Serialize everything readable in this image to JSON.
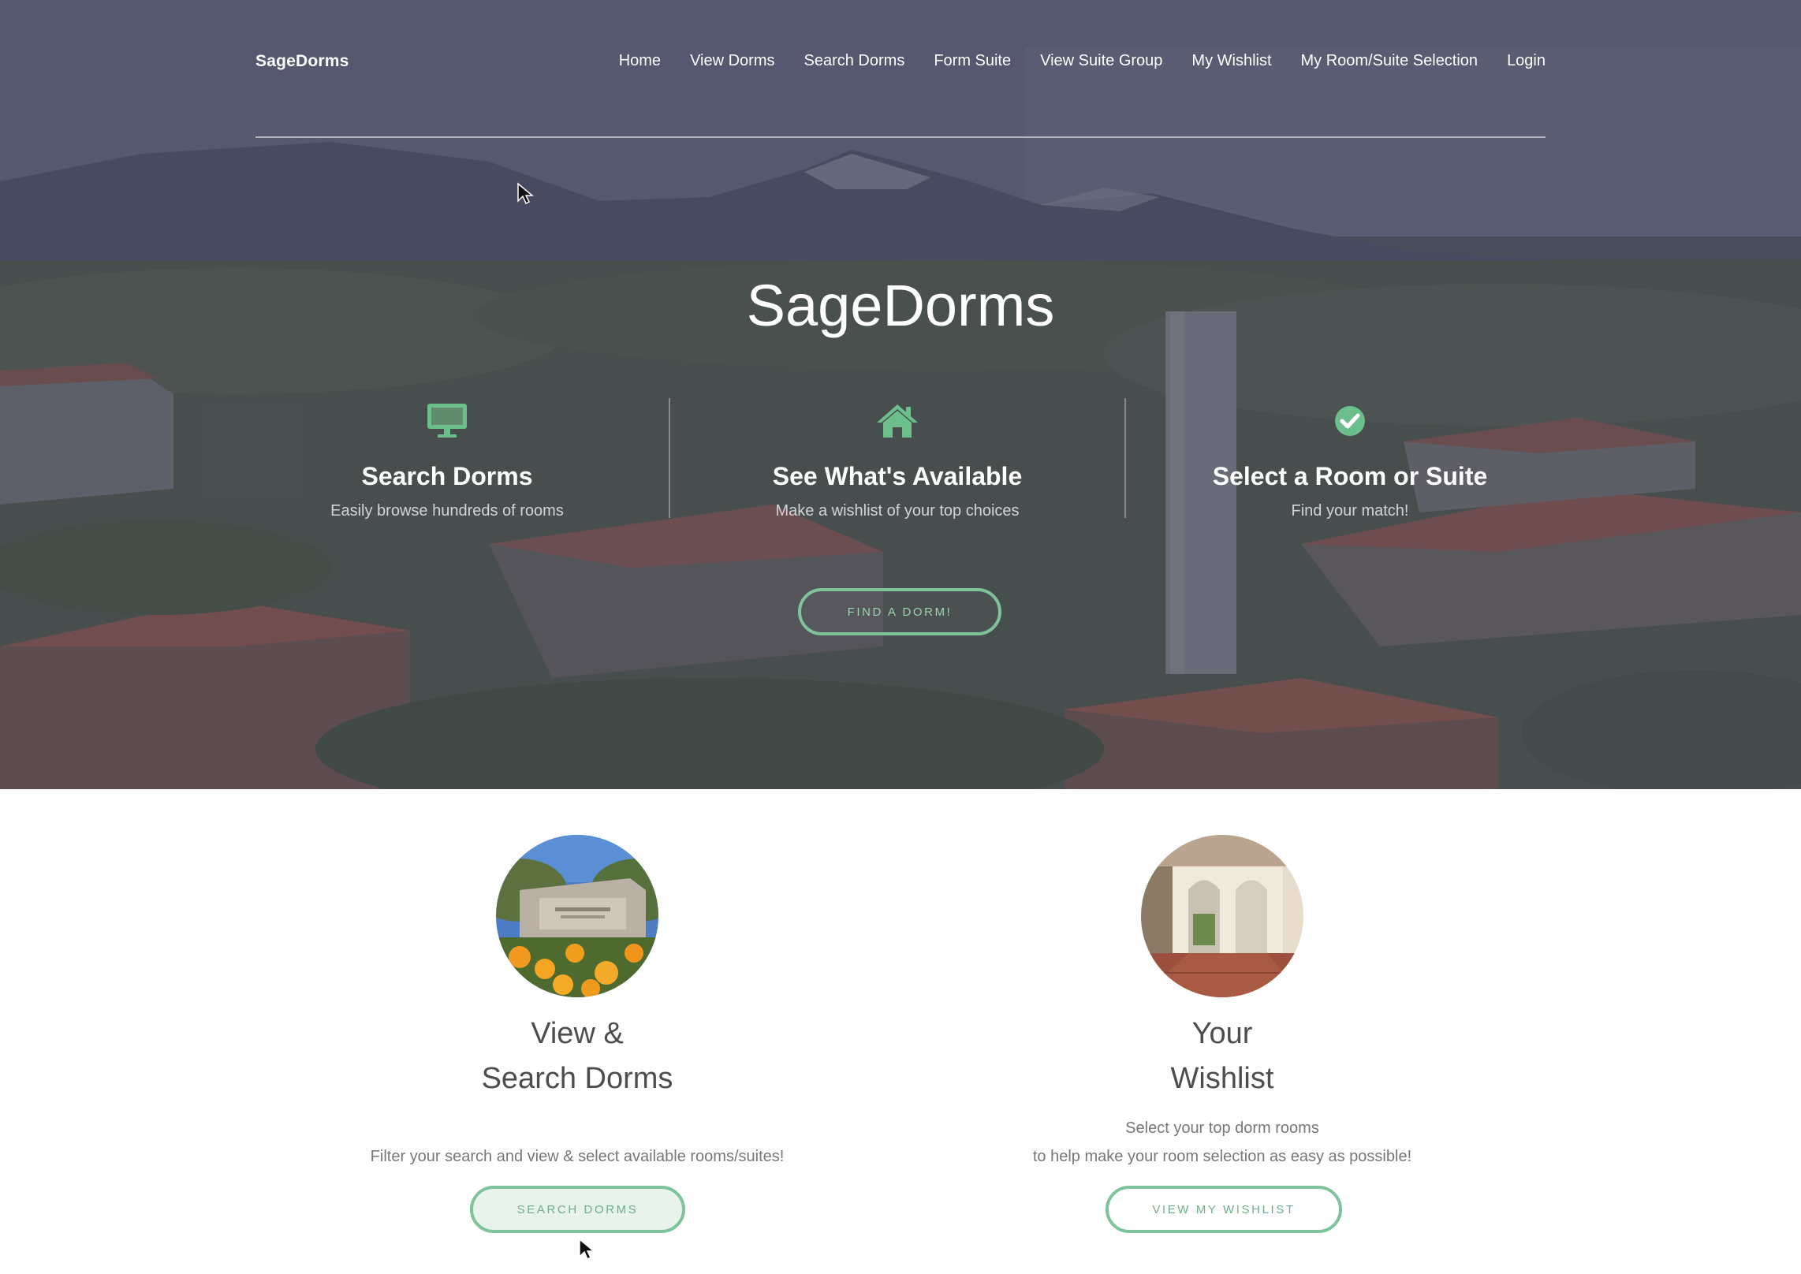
{
  "nav": {
    "brand": "SageDorms",
    "links": [
      "Home",
      "View Dorms",
      "Search Dorms",
      "Form Suite",
      "View Suite Group",
      "My Wishlist",
      "My Room/Suite Selection",
      "Login"
    ]
  },
  "hero": {
    "title": "SageDorms",
    "features": [
      {
        "icon": "monitor-icon",
        "title": "Search Dorms",
        "subtitle": "Easily browse hundreds of rooms"
      },
      {
        "icon": "home-icon",
        "title": "See What's Available",
        "subtitle": "Make a wishlist of your top choices"
      },
      {
        "icon": "check-circle-icon",
        "title": "Select a Room or Suite",
        "subtitle": "Find your match!"
      }
    ],
    "cta": "FIND A DORM!"
  },
  "cards": [
    {
      "title_line1": "View &",
      "title_line2": "Search Dorms",
      "text_line1": "",
      "text_line2": "Filter your search and view & select available rooms/suites!",
      "button": "SEARCH DORMS"
    },
    {
      "title_line1": "Your",
      "title_line2": "Wishlist",
      "text_line1": "Select your top dorm rooms",
      "text_line2": "to help make your room selection as easy as possible!",
      "button": "VIEW MY WISHLIST"
    }
  ],
  "colors": {
    "accent": "#7fc39a",
    "icon_green": "#6cbf8c",
    "text_dark": "#4d4d4d"
  }
}
